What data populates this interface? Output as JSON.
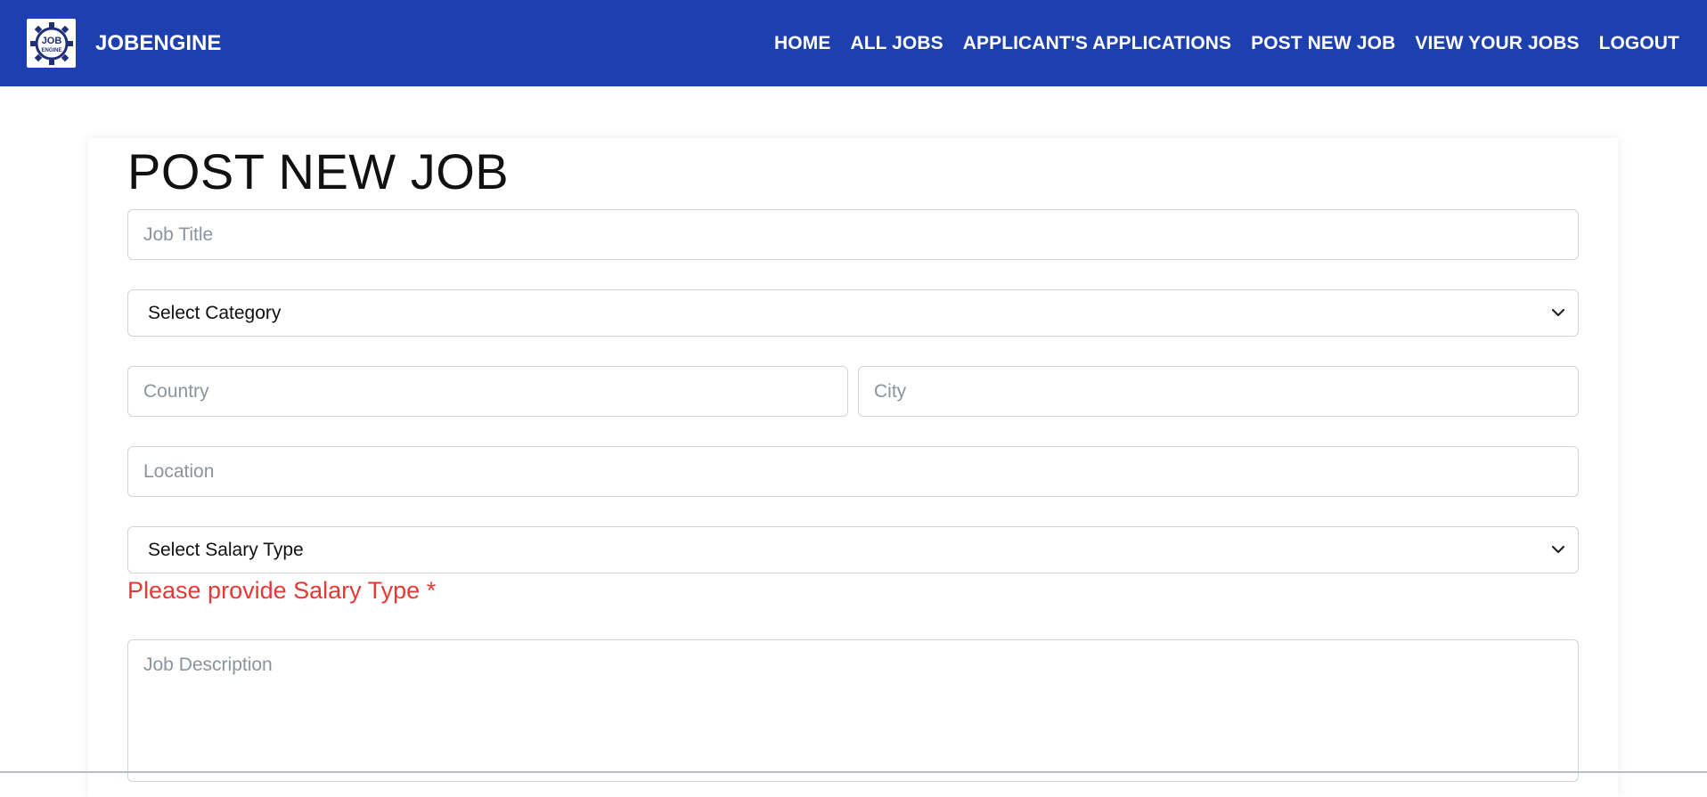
{
  "brand": {
    "name": "JOBENGINE",
    "logo_text_top": "JOB",
    "logo_text_bottom": "ENGINE"
  },
  "nav": {
    "links": [
      "HOME",
      "ALL JOBS",
      "APPLICANT'S APPLICATIONS",
      "POST NEW JOB",
      "VIEW YOUR JOBS",
      "LOGOUT"
    ]
  },
  "form": {
    "title": "POST NEW JOB",
    "job_title_placeholder": "Job Title",
    "category_selected": "Select Category",
    "country_placeholder": "Country",
    "city_placeholder": "City",
    "location_placeholder": "Location",
    "salary_type_selected": "Select Salary Type",
    "salary_error": "Please provide Salary Type *",
    "description_placeholder": "Job Description"
  },
  "colors": {
    "navbar": "#1e40af",
    "error": "#e53935"
  }
}
